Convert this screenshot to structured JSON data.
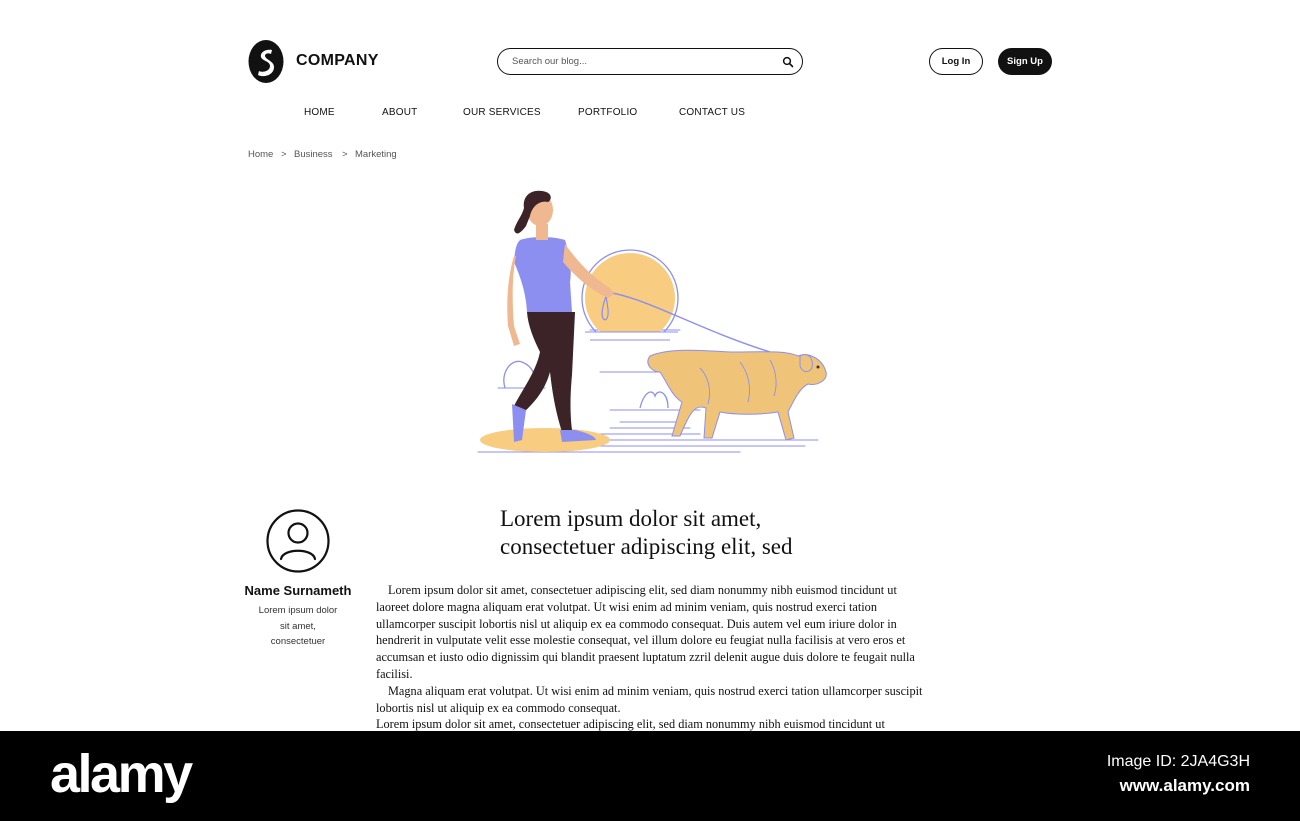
{
  "header": {
    "brand": "COMPANY",
    "search_placeholder": "Search our blog...",
    "login_label": "Log In",
    "signup_label": "Sign Up"
  },
  "nav": [
    "HOME",
    "ABOUT",
    "OUR SERVICES",
    "PORTFOLIO",
    "CONTACT US"
  ],
  "breadcrumb": {
    "items": [
      "Home",
      "Business",
      "Marketing"
    ],
    "separator": ">"
  },
  "author": {
    "name": "Name Surnameth",
    "bio_lines": [
      "Lorem ipsum dolor",
      "sit amet,",
      "consectetuer"
    ]
  },
  "article": {
    "title_lines": [
      "Lorem ipsum dolor sit amet,",
      "consectetuer adipiscing elit, sed"
    ],
    "paragraphs": [
      "Lorem ipsum dolor sit amet, consectetuer adipiscing elit, sed diam nonummy nibh euismod tincidunt ut laoreet dolore magna aliquam erat volutpat. Ut wisi enim ad minim veniam, quis nostrud exerci tation ullamcorper suscipit lobortis nisl ut aliquip ex ea commodo consequat. Duis autem vel eum iriure dolor in hendrerit in vulputate velit esse molestie consequat, vel illum dolore eu feugiat nulla facilisis at vero eros et accumsan et iusto odio dignissim qui blandit praesent luptatum zzril delenit augue duis dolore te feugait nulla facilisi.",
      "Magna aliquam erat volutpat. Ut wisi enim ad minim veniam, quis nostrud exerci tation ullamcorper suscipit lobortis nisl ut aliquip ex ea commodo consequat.",
      "Lorem ipsum dolor sit amet, consectetuer adipiscing elit, sed diam nonummy nibh euismod tincidunt ut"
    ]
  },
  "watermark": {
    "logo": "alamy",
    "image_id": "Image ID: 2JA4G3H",
    "url": "www.alamy.com"
  },
  "colors": {
    "accent_purple": "#8c8ff0",
    "sun_yellow": "#f8cd82",
    "dog_gold": "#f0c478",
    "pants": "#3b2328"
  },
  "icons": [
    "brand-logo-icon",
    "search-icon",
    "user-avatar-icon",
    "woman-walking-dog-illustration"
  ]
}
